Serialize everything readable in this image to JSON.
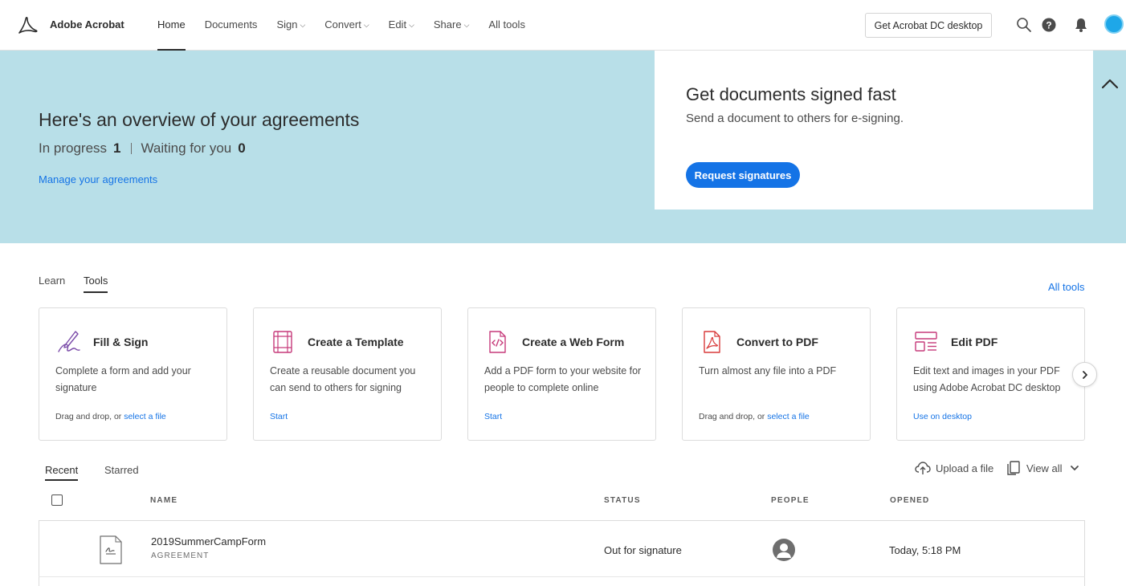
{
  "app": {
    "title": "Adobe Acrobat"
  },
  "nav": {
    "items": [
      {
        "label": "Home",
        "active": true,
        "has_menu": false
      },
      {
        "label": "Documents",
        "active": false,
        "has_menu": false
      },
      {
        "label": "Sign",
        "active": false,
        "has_menu": true
      },
      {
        "label": "Convert",
        "active": false,
        "has_menu": true
      },
      {
        "label": "Edit",
        "active": false,
        "has_menu": true
      },
      {
        "label": "Share",
        "active": false,
        "has_menu": true
      },
      {
        "label": "All tools",
        "active": false,
        "has_menu": false
      }
    ],
    "desktop_button": "Get Acrobat DC desktop",
    "icons": [
      "search-icon",
      "help-icon",
      "bell-icon",
      "avatar"
    ]
  },
  "banner": {
    "title": "Here's an overview of your agreements",
    "in_progress_label": "In progress",
    "in_progress_count": "1",
    "waiting_label": "Waiting for you",
    "waiting_count": "0",
    "manage_link": "Manage your agreements",
    "card": {
      "title": "Get documents signed fast",
      "subtitle": "Send a document to others for e-signing.",
      "button": "Request signatures"
    },
    "background_color": "#b8dfe8"
  },
  "tools_section": {
    "tabs": [
      {
        "label": "Learn",
        "active": false
      },
      {
        "label": "Tools",
        "active": true
      }
    ],
    "all_tools_link": "All tools",
    "cards": [
      {
        "title": "Fill & Sign",
        "description": "Complete a form and add your signature",
        "foot_text": "Drag and drop, or ",
        "foot_link": "select a file",
        "icon": "fill-sign-icon"
      },
      {
        "title": "Create a Template",
        "description": "Create a reusable document you can send to others for signing",
        "foot_text": "",
        "foot_link": "Start",
        "icon": "template-icon"
      },
      {
        "title": "Create a Web Form",
        "description": "Add a PDF form to your website for people to complete online",
        "foot_text": "",
        "foot_link": "Start",
        "icon": "web-form-icon"
      },
      {
        "title": "Convert to PDF",
        "description": "Turn almost any file into a PDF",
        "foot_text": "Drag and drop, or ",
        "foot_link": "select a file",
        "icon": "pdf-icon"
      },
      {
        "title": "Edit PDF",
        "description": "Edit text and images in your PDF using Adobe Acrobat DC desktop",
        "foot_text": "",
        "foot_link": "Use on desktop",
        "icon": "edit-pdf-icon"
      }
    ]
  },
  "recent": {
    "tabs": [
      {
        "label": "Recent",
        "active": true
      },
      {
        "label": "Starred",
        "active": false
      }
    ],
    "upload_label": "Upload a file",
    "view_all_label": "View all",
    "columns": {
      "name": "NAME",
      "status": "STATUS",
      "people": "PEOPLE",
      "opened": "OPENED"
    },
    "rows": [
      {
        "name": "2019SummerCampForm",
        "type": "AGREEMENT",
        "status": "Out for signature",
        "opened": "Today, 5:18 PM"
      }
    ]
  },
  "colors": {
    "accent": "#1473e6",
    "icon_red": "#d83a3a",
    "icon_magenta": "#c63a7a",
    "icon_purple": "#7a4aa8"
  }
}
